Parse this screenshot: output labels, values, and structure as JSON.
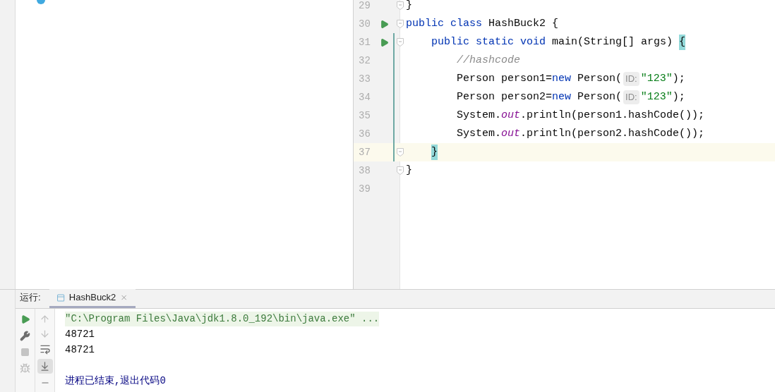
{
  "editor": {
    "lines": [
      {
        "number": "29",
        "run": false,
        "fold": true,
        "changed": false,
        "current": false,
        "segments": [
          {
            "text": "}",
            "kind": "plain"
          }
        ]
      },
      {
        "number": "30",
        "run": true,
        "fold": true,
        "changed": false,
        "current": false,
        "segments": [
          {
            "text": "public class ",
            "kind": "keyword"
          },
          {
            "text": "HashBuck2 {",
            "kind": "plain"
          }
        ]
      },
      {
        "number": "31",
        "run": true,
        "fold": true,
        "changed": true,
        "current": false,
        "segments": [
          {
            "text": "    public static void ",
            "kind": "keyword"
          },
          {
            "text": "main(String[] args) ",
            "kind": "plain"
          },
          {
            "text": "{",
            "kind": "match"
          }
        ]
      },
      {
        "number": "32",
        "run": false,
        "fold": false,
        "changed": true,
        "current": false,
        "segments": [
          {
            "text": "        //hashcode",
            "kind": "comment"
          }
        ]
      },
      {
        "number": "33",
        "run": false,
        "fold": false,
        "changed": true,
        "current": false,
        "segments": [
          {
            "text": "        Person person1=",
            "kind": "plain"
          },
          {
            "text": "new ",
            "kind": "keyword"
          },
          {
            "text": "Person(",
            "kind": "plain"
          },
          {
            "text": "ID:",
            "kind": "hint"
          },
          {
            "text": "\"123\"",
            "kind": "string"
          },
          {
            "text": ");",
            "kind": "plain"
          }
        ]
      },
      {
        "number": "34",
        "run": false,
        "fold": false,
        "changed": true,
        "current": false,
        "segments": [
          {
            "text": "        Person person2=",
            "kind": "plain"
          },
          {
            "text": "new ",
            "kind": "keyword"
          },
          {
            "text": "Person(",
            "kind": "plain"
          },
          {
            "text": "ID:",
            "kind": "hint"
          },
          {
            "text": "\"123\"",
            "kind": "string"
          },
          {
            "text": ");",
            "kind": "plain"
          }
        ]
      },
      {
        "number": "35",
        "run": false,
        "fold": false,
        "changed": true,
        "current": false,
        "segments": [
          {
            "text": "        System.",
            "kind": "plain"
          },
          {
            "text": "out",
            "kind": "field"
          },
          {
            "text": ".println(person1.hashCode());",
            "kind": "plain"
          }
        ]
      },
      {
        "number": "36",
        "run": false,
        "fold": false,
        "changed": true,
        "current": false,
        "segments": [
          {
            "text": "        System.",
            "kind": "plain"
          },
          {
            "text": "out",
            "kind": "field"
          },
          {
            "text": ".println(person2.hashCode());",
            "kind": "plain"
          }
        ]
      },
      {
        "number": "37",
        "run": false,
        "fold": true,
        "changed": true,
        "current": true,
        "segments": [
          {
            "text": "    }",
            "kind": "match"
          }
        ]
      },
      {
        "number": "38",
        "run": false,
        "fold": true,
        "changed": false,
        "current": false,
        "segments": [
          {
            "text": "}",
            "kind": "plain"
          }
        ]
      },
      {
        "number": "39",
        "run": false,
        "fold": false,
        "changed": false,
        "current": false
      }
    ]
  },
  "run_panel": {
    "label": "运行:",
    "tabs": [
      {
        "title": "HashBuck2",
        "selected": true
      }
    ],
    "console": [
      {
        "text": "\"C:\\Program Files\\Java\\jdk1.8.0_192\\bin\\java.exe\" ...",
        "kind": "command"
      },
      {
        "text": "48721",
        "kind": "output"
      },
      {
        "text": "48721",
        "kind": "output"
      },
      {
        "kind": "blank"
      },
      {
        "text": "进程已结束,退出代码0",
        "kind": "exit"
      }
    ]
  }
}
